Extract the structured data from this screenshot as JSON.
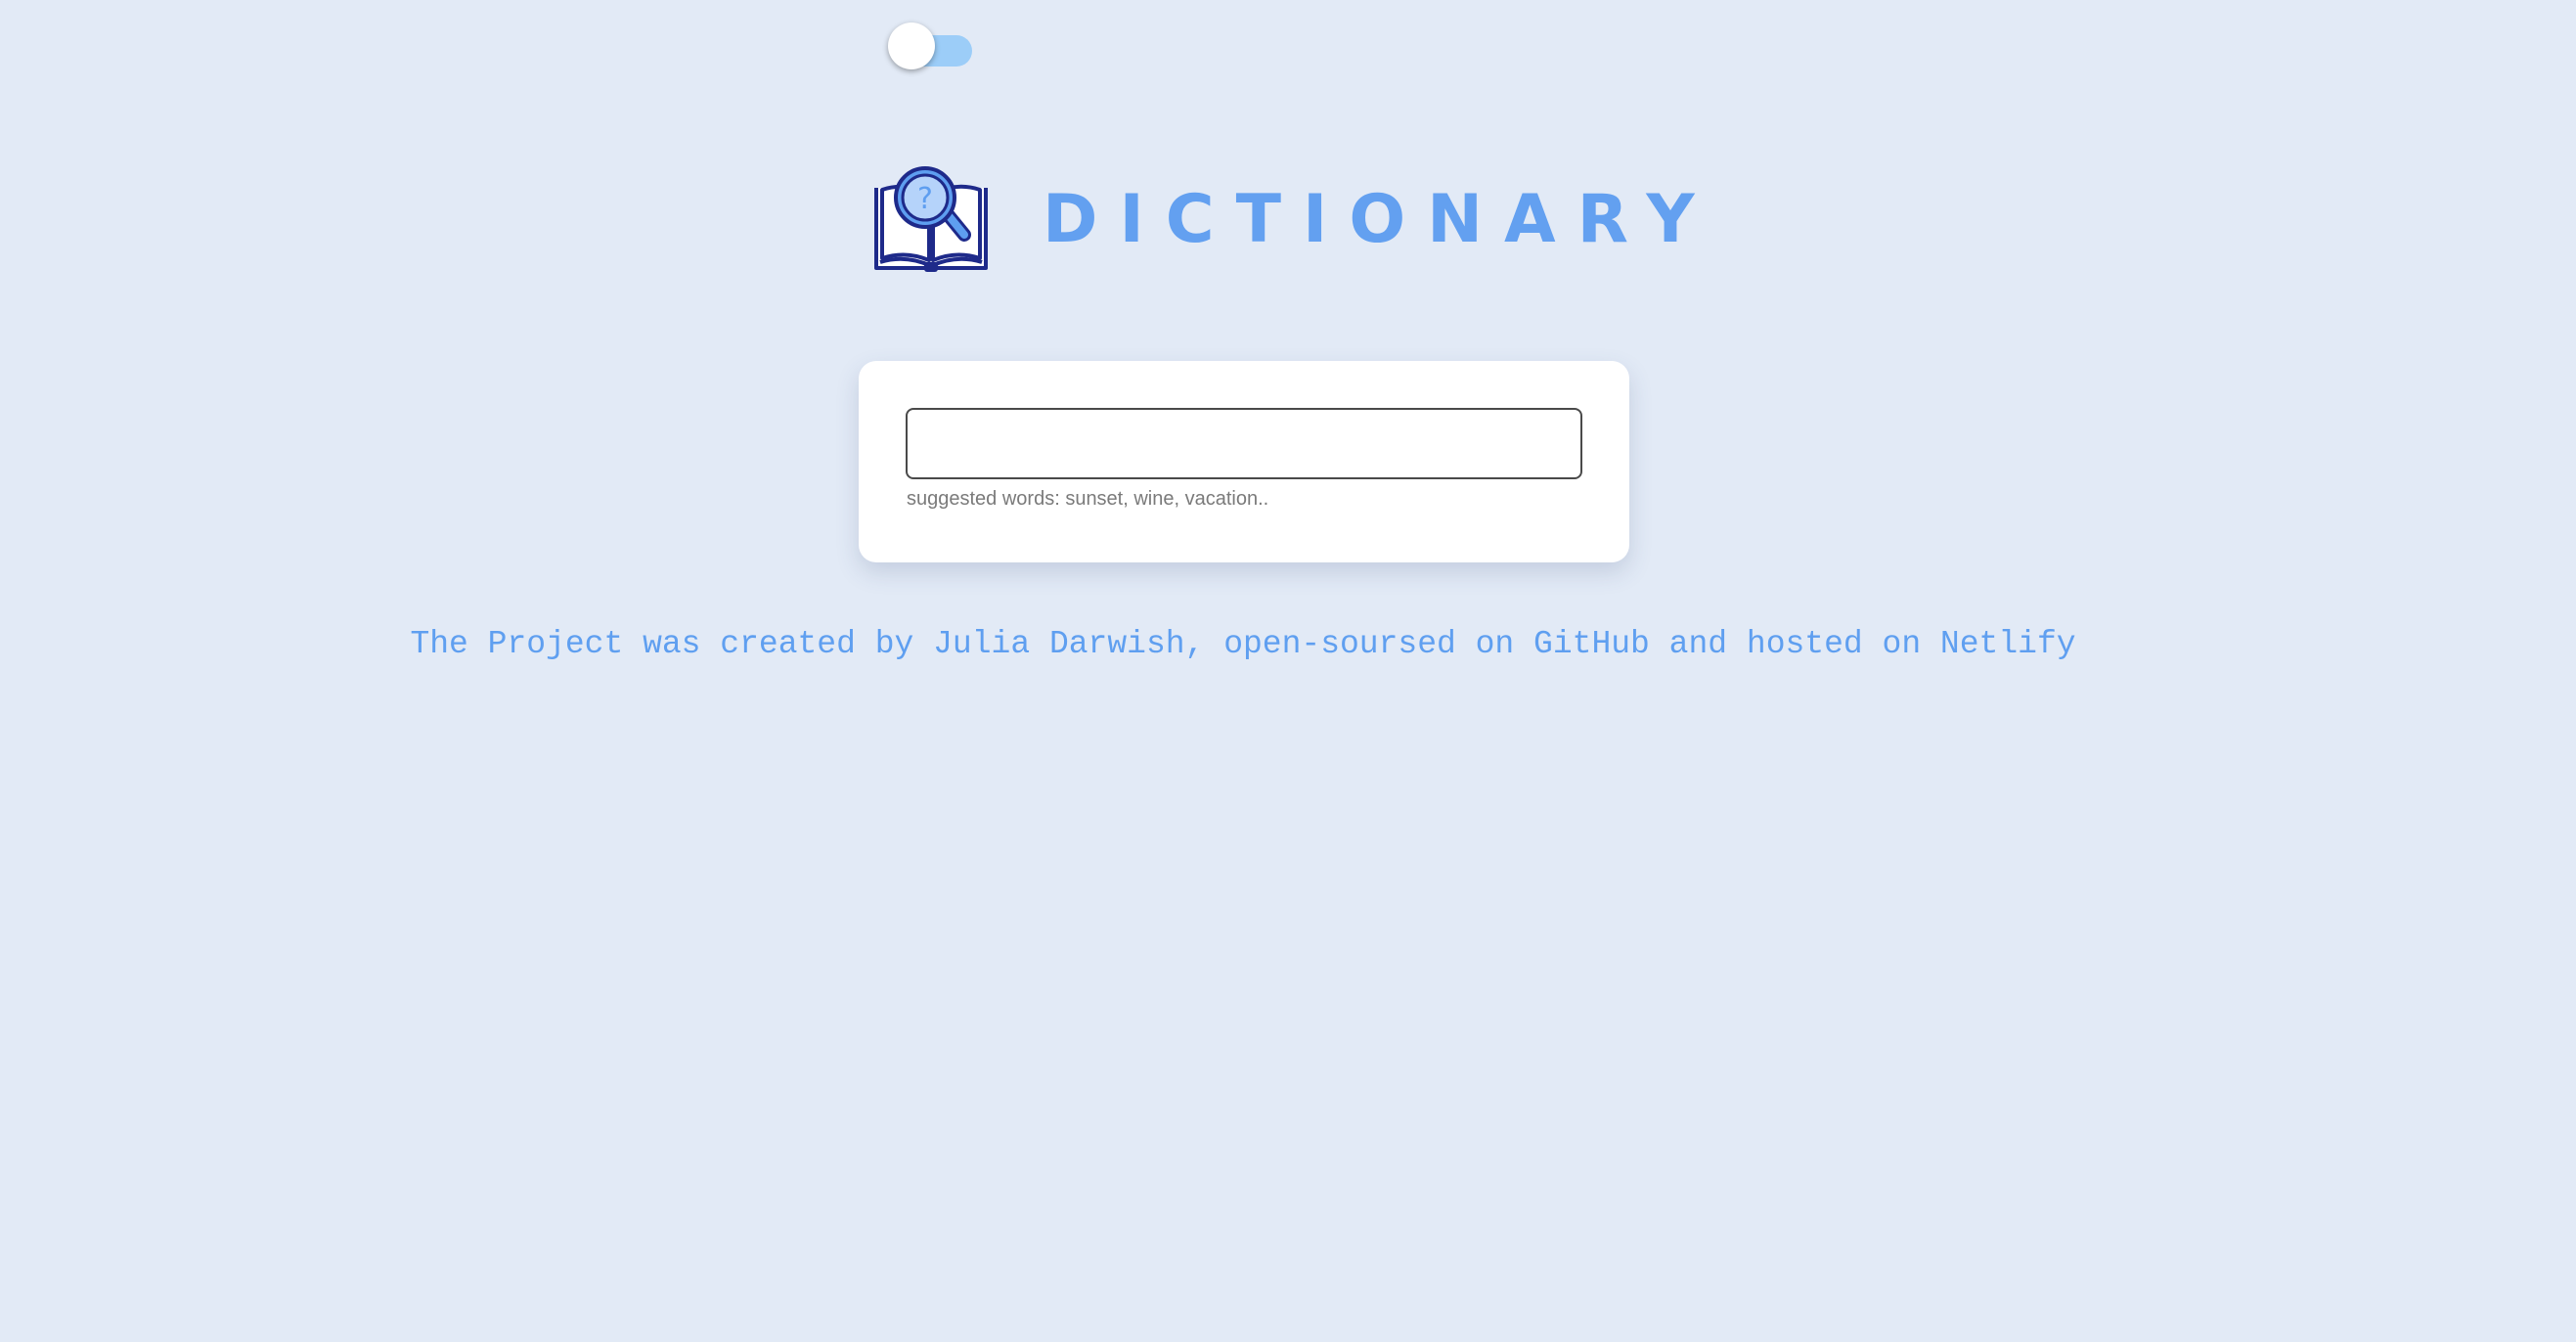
{
  "theme_toggle": {
    "state": "off",
    "track_color": "#9ccdf8",
    "knob_color": "#ffffff"
  },
  "header": {
    "logo_icon": "book-magnifier-question-icon",
    "title": "DICTIONARY",
    "title_color": "#63a0f0"
  },
  "search": {
    "value": "",
    "placeholder": "",
    "hint": "suggested words: sunset, wine, vacation.."
  },
  "footer": {
    "text_1": "The Project was created by ",
    "author_link": "Julia Darwish",
    "text_2": ", ",
    "repo_link": "open-soursed on GitHub",
    "text_3": " and ",
    "host_link": "hosted on Netlify",
    "color": "#5f9ff0"
  },
  "background_color": "#e2eaf6"
}
